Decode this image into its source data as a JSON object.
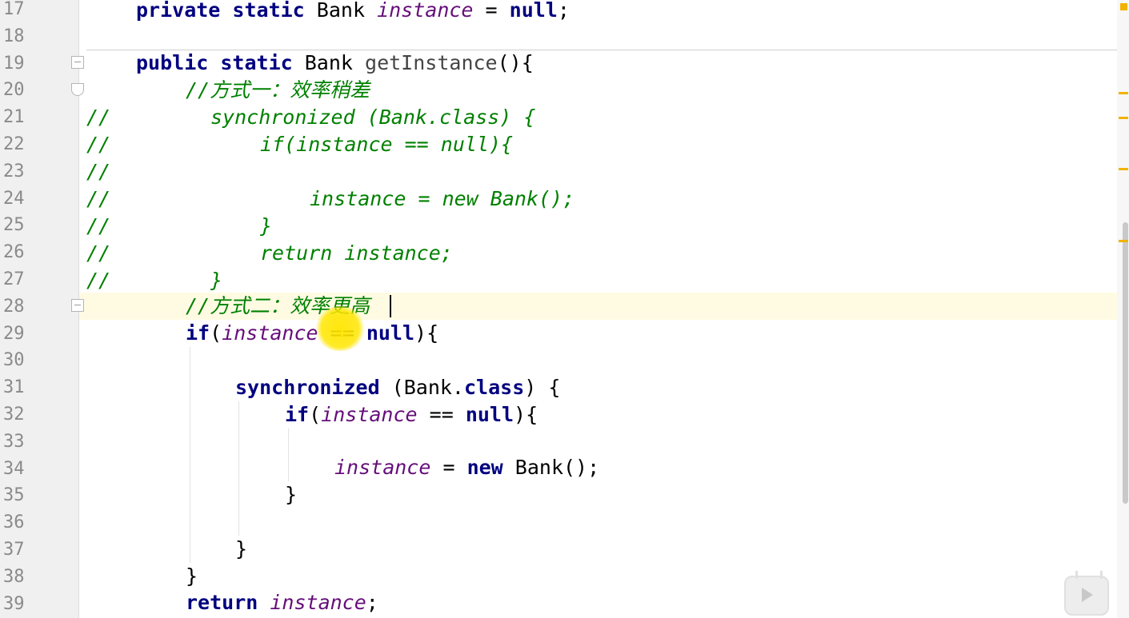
{
  "gutter": {
    "line_numbers": [
      "17",
      "18",
      "19",
      "20",
      "21",
      "22",
      "23",
      "24",
      "25",
      "26",
      "27",
      "28",
      "29",
      "30",
      "31",
      "32",
      "33",
      "34",
      "35",
      "36",
      "37",
      "38",
      "39"
    ]
  },
  "code": {
    "l17": {
      "kw1": "private",
      "kw2": "static",
      "type": "Bank",
      "field": "instance",
      "op": " = ",
      "kw3": "null",
      "end": ";"
    },
    "l19": {
      "kw1": "public",
      "kw2": "static",
      "type": "Bank",
      "method": "getInstance",
      "end": "(){"
    },
    "l20": {
      "comment": "//方式一：效率稍差"
    },
    "l21": {
      "prefix": "//",
      "comment": "synchronized (Bank.class) {"
    },
    "l22": {
      "prefix": "//",
      "comment": "if(instance == null){"
    },
    "l23": {
      "prefix": "//"
    },
    "l24": {
      "prefix": "//",
      "comment": "instance = new Bank();"
    },
    "l25": {
      "prefix": "//",
      "comment": "}"
    },
    "l26": {
      "prefix": "//",
      "comment": "return instance;"
    },
    "l27": {
      "prefix": "//",
      "comment": "}"
    },
    "l28": {
      "comment": "//方式二：效率更高"
    },
    "l29": {
      "kw1": "if",
      "open": "(",
      "field": "instance",
      "op": " == ",
      "kw2": "null",
      "end": "){"
    },
    "l31": {
      "kw1": "synchronized",
      "mid": " (Bank.",
      "kw2": "class",
      "end": ") {"
    },
    "l32": {
      "kw1": "if",
      "open": "(",
      "field": "instance",
      "op": " == ",
      "kw2": "null",
      "end": "){"
    },
    "l34": {
      "field": "instance",
      "op": " = ",
      "kw1": "new",
      "end": " Bank();"
    },
    "l35": {
      "text": "}"
    },
    "l37": {
      "text": "}"
    },
    "l38": {
      "text": "}"
    },
    "l39": {
      "kw1": "return",
      "field": "instance",
      "end": ";"
    }
  },
  "colors": {
    "keyword": "#000080",
    "field": "#660e7a",
    "comment": "#008000",
    "caret_row": "#fffbe3",
    "marker": "#f2b200",
    "cursor_highlight": "#ffe600"
  }
}
